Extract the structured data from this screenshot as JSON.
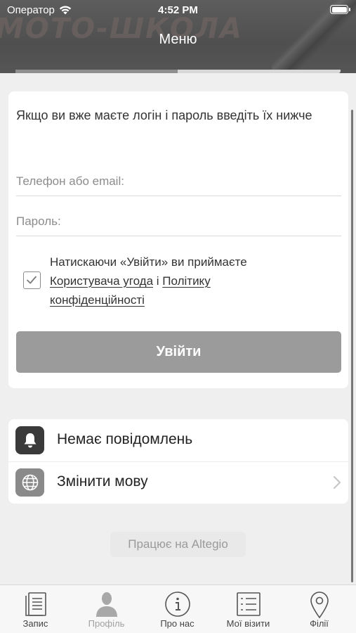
{
  "status_bar": {
    "carrier": "Оператор",
    "time": "4:52 PM"
  },
  "header": {
    "title": "Меню",
    "watermark_text": "МОТО-ШКОЛА"
  },
  "login": {
    "intro": "Якщо ви вже маєте логін і пароль введіть їх нижче",
    "phone_placeholder": "Телефон або email:",
    "password_placeholder": "Пароль:",
    "checkbox_checked": true,
    "terms_prefix": "Натискаючи «Увійти» ви приймаєте",
    "terms_link_agreement": "Користувача угода",
    "terms_and": "і",
    "terms_link_policy_1": "Політику",
    "terms_link_policy_2": "конфіденційності",
    "login_button": "Увійти"
  },
  "settings": {
    "notifications_label": "Немає повідомлень",
    "notifications_icon": "bell-icon",
    "language_label": "Змінити мову",
    "language_icon": "globe-icon"
  },
  "powered_by": "Працює на Altegio",
  "tabbar": [
    {
      "label": "Запис",
      "icon": "document-icon",
      "active": true
    },
    {
      "label": "Профіль",
      "icon": "person-icon",
      "active": false
    },
    {
      "label": "Про нас",
      "icon": "info-icon",
      "active": true
    },
    {
      "label": "Мої візити",
      "icon": "list-icon",
      "active": true
    },
    {
      "label": "Філії",
      "icon": "location-pin-icon",
      "active": true
    }
  ],
  "colors": {
    "header_bg": "#555555",
    "login_button_bg": "#9b9b9b",
    "page_bg": "#efefef"
  }
}
